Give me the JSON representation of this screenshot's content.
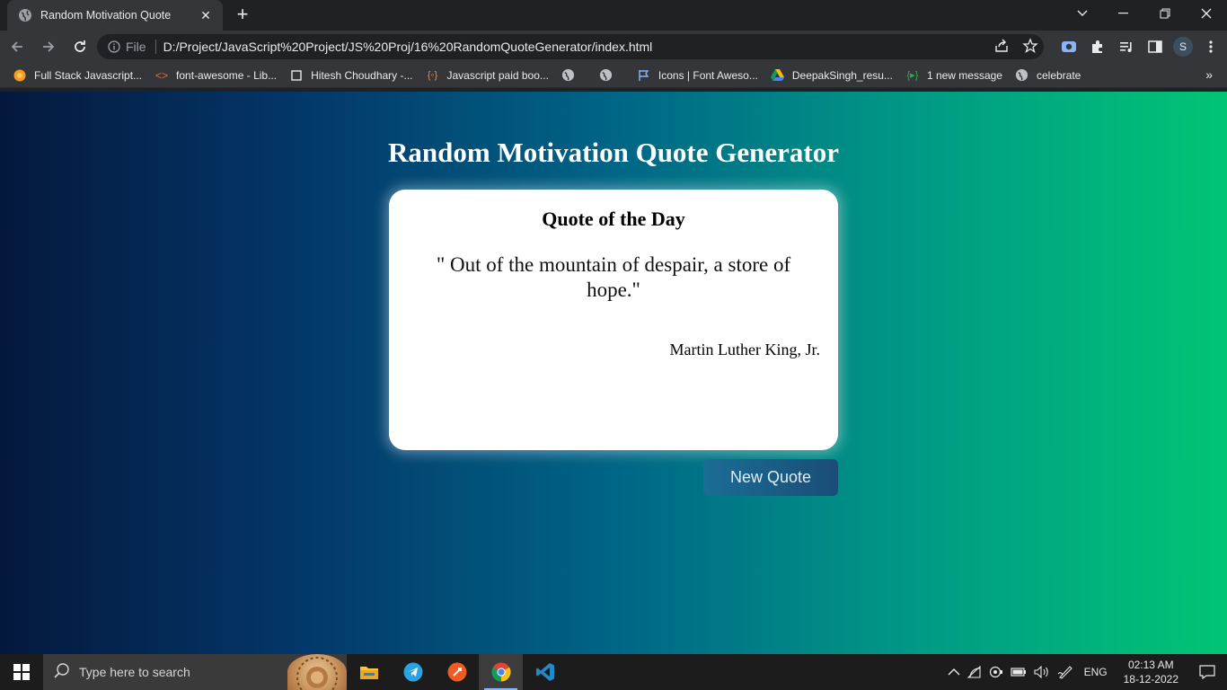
{
  "browser": {
    "tab_title": "Random Motivation Quote",
    "omnibox": {
      "scheme_label": "File",
      "url": "D:/Project/JavaScript%20Project/JS%20Proj/16%20RandomQuoteGenerator/index.html"
    },
    "profile_initial": "S",
    "bookmarks": [
      {
        "label": "Full Stack Javascript...",
        "icon": "orange-circle-icon"
      },
      {
        "label": "font-awesome - Lib...",
        "icon": "code-brackets-icon"
      },
      {
        "label": "Hitesh Choudhary -...",
        "icon": "square-outline-icon"
      },
      {
        "label": "Javascript paid boo...",
        "icon": "braces-icon"
      },
      {
        "label": "",
        "icon": "globe-icon"
      },
      {
        "label": "",
        "icon": "globe-icon"
      },
      {
        "label": "Icons | Font Aweso...",
        "icon": "flag-icon"
      },
      {
        "label": "DeepakSingh_resu...",
        "icon": "google-drive-icon"
      },
      {
        "label": "1 new message",
        "icon": "chat-icon"
      },
      {
        "label": "celebrate",
        "icon": "globe-icon"
      }
    ]
  },
  "page": {
    "heading": "Random Motivation Quote Generator",
    "card": {
      "title": "Quote of the Day",
      "quote": "\" Out of the mountain of despair, a store of hope.\"",
      "author": "Martin Luther King, Jr."
    },
    "new_quote_label": "New Quote"
  },
  "taskbar": {
    "search_placeholder": "Type here to search",
    "language": "ENG",
    "time": "02:13 AM",
    "date": "18-12-2022"
  }
}
